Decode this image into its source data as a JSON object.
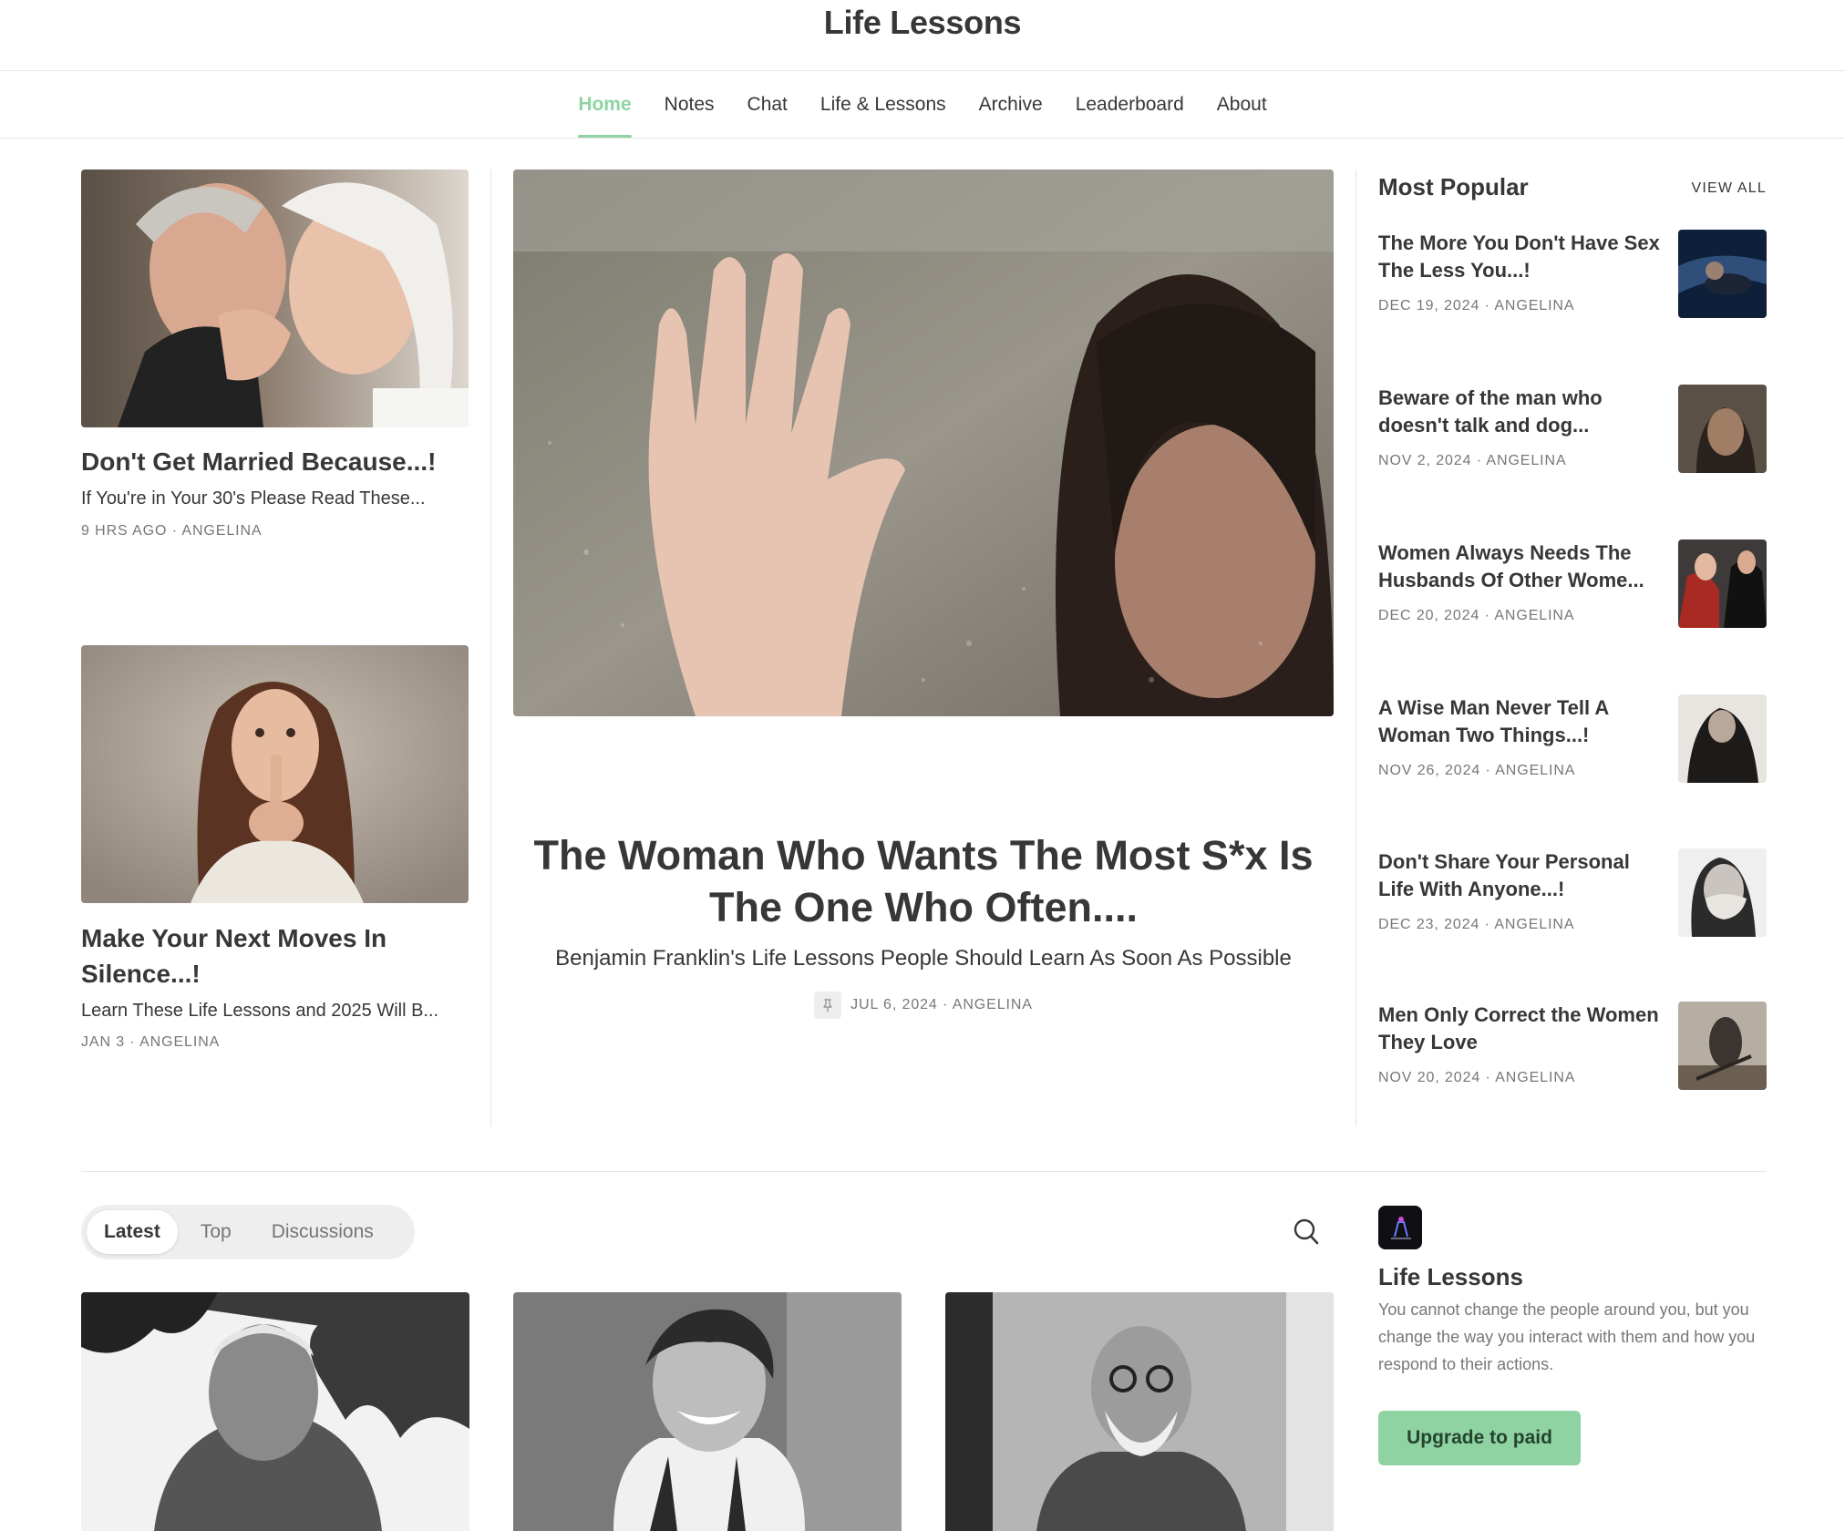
{
  "site": {
    "title": "Life Lessons"
  },
  "nav": {
    "items": [
      "Home",
      "Notes",
      "Chat",
      "Life & Lessons",
      "Archive",
      "Leaderboard",
      "About"
    ],
    "active": "Home",
    "accent_color": "#8fd3a3"
  },
  "featured_left": [
    {
      "title": "Don't Get Married Because...!",
      "subtitle": "If You're in Your 30's Please Read These...",
      "meta": "9 HRS AGO · ANGELINA",
      "image": "elderly-couple-kissing"
    },
    {
      "title": "Make Your Next Moves In Silence...!",
      "subtitle": "Learn These Life Lessons and 2025 Will B...",
      "meta": "JAN 3 · ANGELINA",
      "image": "woman-finger-on-lips"
    }
  ],
  "hero": {
    "title": "The Woman Who Wants The Most S*x Is The One Who Often....",
    "subtitle": "Benjamin Franklin's Life Lessons People Should Learn As Soon As Possible",
    "meta": "JUL 6, 2024 · ANGELINA",
    "pinned_icon": "pin-icon",
    "image": "hand-on-wet-glass"
  },
  "most_popular": {
    "heading": "Most Popular",
    "view_all": "VIEW ALL",
    "items": [
      {
        "title": "The More You Don't Have Sex The Less You...!",
        "meta": "DEC 19, 2024 · ANGELINA",
        "image": "couple-underwater"
      },
      {
        "title": "Beware of the man who doesn't talk and dog...",
        "meta": "NOV 2, 2024 · ANGELINA",
        "image": "old-man-portrait"
      },
      {
        "title": "Women Always Needs The Husbands Of Other Wome...",
        "meta": "DEC 20, 2024 · ANGELINA",
        "image": "woman-in-red-with-man"
      },
      {
        "title": "A Wise Man Never Tell A Woman Two Things...!",
        "meta": "NOV 26, 2024 · ANGELINA",
        "image": "couple-embrace"
      },
      {
        "title": "Don't Share Your Personal Life With Anyone...!",
        "meta": "DEC 23, 2024 · ANGELINA",
        "image": "woman-covering-mouth"
      },
      {
        "title": "Men Only Correct the Women They Love",
        "meta": "NOV 20, 2024 · ANGELINA",
        "image": "figure-with-sword"
      }
    ]
  },
  "feed": {
    "tabs": [
      "Latest",
      "Top",
      "Discussions"
    ],
    "active_tab": "Latest",
    "search_icon": "search-icon",
    "post_images": [
      "elderly-man-bw",
      "young-man-smiling-bw",
      "bearded-man-glasses-bw"
    ]
  },
  "about": {
    "title": "Life Lessons",
    "description": "You cannot change the people around you, but you change the way you interact with them and how you respond to their actions.",
    "button": "Upgrade to paid"
  }
}
